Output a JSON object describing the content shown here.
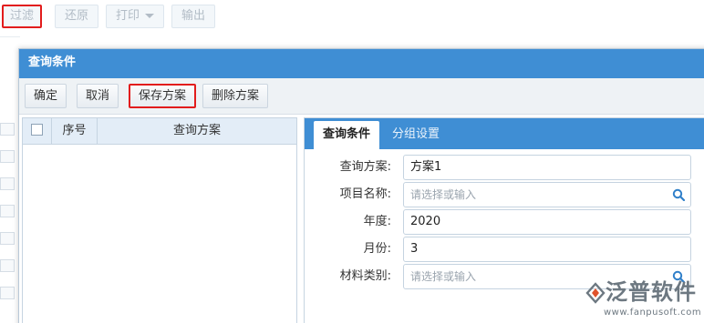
{
  "toolbar": {
    "filter": "过滤",
    "restore": "还原",
    "print": "打印",
    "export": "输出"
  },
  "dialog": {
    "title": "查询条件",
    "buttons": {
      "confirm": "确定",
      "cancel": "取消",
      "save_plan": "保存方案",
      "delete_plan": "删除方案"
    },
    "grid": {
      "columns": [
        "序号",
        "查询方案"
      ]
    },
    "tabs": {
      "query": "查询条件",
      "group": "分组设置"
    },
    "form": {
      "plan": {
        "label": "查询方案:",
        "value": "方案1"
      },
      "project": {
        "label": "项目名称:",
        "placeholder": "请选择或输入"
      },
      "year": {
        "label": "年度:",
        "value": "2020"
      },
      "month": {
        "label": "月份:",
        "value": "3"
      },
      "material": {
        "label": "材料类别:",
        "placeholder": "请选择或输入"
      }
    }
  },
  "watermark": {
    "brand": "泛普软件",
    "url": "www.fanpusoft.com"
  },
  "colors": {
    "accent": "#3f8ed4",
    "highlight": "#e21c1c"
  }
}
